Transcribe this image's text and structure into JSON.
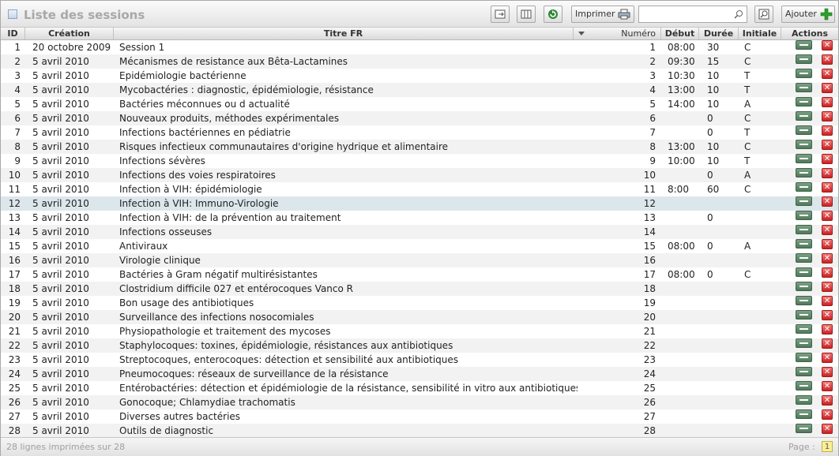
{
  "header": {
    "title": "Liste des sessions",
    "print_label": "Imprimer",
    "add_label": "Ajouter",
    "search_value": ""
  },
  "columns": {
    "id": "ID",
    "creation": "Création",
    "titre": "Titre FR",
    "numero": "Numéro",
    "debut": "Début",
    "duree": "Durée",
    "initiale": "Initiale",
    "actions": "Actions"
  },
  "rows": [
    {
      "id": "1",
      "creation": "20 octobre 2009",
      "titre": "Session 1",
      "numero": "1",
      "debut": "08:00",
      "duree": "30",
      "initiale": "C"
    },
    {
      "id": "2",
      "creation": "5 avril 2010",
      "titre": "Mécanismes de resistance aux Bêta-Lactamines",
      "numero": "2",
      "debut": "09:30",
      "duree": "15",
      "initiale": "C"
    },
    {
      "id": "3",
      "creation": "5 avril 2010",
      "titre": "Epidémiologie bactérienne",
      "numero": "3",
      "debut": "10:30",
      "duree": "10",
      "initiale": "T"
    },
    {
      "id": "4",
      "creation": "5 avril 2010",
      "titre": "Mycobactéries : diagnostic, épidémiologie, résistance",
      "numero": "4",
      "debut": "13:00",
      "duree": "10",
      "initiale": "T"
    },
    {
      "id": "5",
      "creation": "5 avril 2010",
      "titre": "Bactéries méconnues ou d   actualité",
      "numero": "5",
      "debut": "14:00",
      "duree": "10",
      "initiale": "A"
    },
    {
      "id": "6",
      "creation": "5 avril 2010",
      "titre": "Nouveaux produits, méthodes expérimentales",
      "numero": "6",
      "debut": "",
      "duree": "0",
      "initiale": "C"
    },
    {
      "id": "7",
      "creation": "5 avril 2010",
      "titre": "Infections bactériennes en pédiatrie",
      "numero": "7",
      "debut": "",
      "duree": "0",
      "initiale": "T"
    },
    {
      "id": "8",
      "creation": "5 avril 2010",
      "titre": "Risques infectieux communautaires d'origine hydrique et alimentaire",
      "numero": "8",
      "debut": "13:00",
      "duree": "10",
      "initiale": "C"
    },
    {
      "id": "9",
      "creation": "5 avril 2010",
      "titre": "Infections sévères",
      "numero": "9",
      "debut": "10:00",
      "duree": "10",
      "initiale": "T"
    },
    {
      "id": "10",
      "creation": "5 avril 2010",
      "titre": "Infections des voies respiratoires",
      "numero": "10",
      "debut": "",
      "duree": "0",
      "initiale": "A"
    },
    {
      "id": "11",
      "creation": "5 avril 2010",
      "titre": "Infection à VIH: épidémiologie",
      "numero": "11",
      "debut": "8:00",
      "duree": "60",
      "initiale": "C"
    },
    {
      "id": "12",
      "creation": "5 avril 2010",
      "titre": "Infection à VIH: Immuno-Virologie",
      "numero": "12",
      "debut": "",
      "duree": "",
      "initiale": ""
    },
    {
      "id": "13",
      "creation": "5 avril 2010",
      "titre": "Infection à VIH: de la prévention au traitement",
      "numero": "13",
      "debut": "",
      "duree": "0",
      "initiale": ""
    },
    {
      "id": "14",
      "creation": "5 avril 2010",
      "titre": "Infections osseuses",
      "numero": "14",
      "debut": "",
      "duree": "",
      "initiale": ""
    },
    {
      "id": "15",
      "creation": "5 avril 2010",
      "titre": "Antiviraux",
      "numero": "15",
      "debut": "08:00",
      "duree": "0",
      "initiale": "A"
    },
    {
      "id": "16",
      "creation": "5 avril 2010",
      "titre": "Virologie clinique",
      "numero": "16",
      "debut": "",
      "duree": "",
      "initiale": ""
    },
    {
      "id": "17",
      "creation": "5 avril 2010",
      "titre": "Bactéries à Gram négatif multirésistantes",
      "numero": "17",
      "debut": "08:00",
      "duree": "0",
      "initiale": "C"
    },
    {
      "id": "18",
      "creation": "5 avril 2010",
      "titre": "Clostridium difficile 027 et entérocoques Vanco R",
      "numero": "18",
      "debut": "",
      "duree": "",
      "initiale": ""
    },
    {
      "id": "19",
      "creation": "5 avril 2010",
      "titre": "Bon usage des antibiotiques",
      "numero": "19",
      "debut": "",
      "duree": "",
      "initiale": ""
    },
    {
      "id": "20",
      "creation": "5 avril 2010",
      "titre": "Surveillance des infections nosocomiales",
      "numero": "20",
      "debut": "",
      "duree": "",
      "initiale": ""
    },
    {
      "id": "21",
      "creation": "5 avril 2010",
      "titre": "Physiopathologie et traitement des mycoses",
      "numero": "21",
      "debut": "",
      "duree": "",
      "initiale": ""
    },
    {
      "id": "22",
      "creation": "5 avril 2010",
      "titre": "Staphylocoques: toxines, épidémiologie, résistances aux antibiotiques",
      "numero": "22",
      "debut": "",
      "duree": "",
      "initiale": ""
    },
    {
      "id": "23",
      "creation": "5 avril 2010",
      "titre": "Streptocoques, enterocoques: détection et sensibilité aux antibiotiques",
      "numero": "23",
      "debut": "",
      "duree": "",
      "initiale": ""
    },
    {
      "id": "24",
      "creation": "5 avril 2010",
      "titre": "Pneumocoques: réseaux de surveillance de la résistance",
      "numero": "24",
      "debut": "",
      "duree": "",
      "initiale": ""
    },
    {
      "id": "25",
      "creation": "5 avril 2010",
      "titre": "Entérobactéries: détection et épidémiologie de la résistance, sensibilité in vitro aux antibiotiques",
      "numero": "25",
      "debut": "",
      "duree": "",
      "initiale": ""
    },
    {
      "id": "26",
      "creation": "5 avril 2010",
      "titre": "Gonocoque; Chlamydiae trachomatis",
      "numero": "26",
      "debut": "",
      "duree": "",
      "initiale": ""
    },
    {
      "id": "27",
      "creation": "5 avril 2010",
      "titre": "Diverses autres bactéries",
      "numero": "27",
      "debut": "",
      "duree": "",
      "initiale": ""
    },
    {
      "id": "28",
      "creation": "5 avril 2010",
      "titre": "Outils de diagnostic",
      "numero": "28",
      "debut": "",
      "duree": "",
      "initiale": ""
    }
  ],
  "selected_row": 12,
  "footer": {
    "summary": "28 lignes imprimées sur 28",
    "page_label": "Page :",
    "current_page": "1"
  },
  "icons": {
    "title": "sessions-icon",
    "export": "export-icon",
    "columns": "columns-icon",
    "refresh": "refresh-icon",
    "print": "printer-icon",
    "search": "search-icon",
    "advanced_search": "advanced-search-icon",
    "add": "plus-icon",
    "edit": "edit-icon",
    "delete": "delete-icon"
  },
  "colors": {
    "title": "#a8a8a8",
    "selected_row": "#dce7ec",
    "alt_row": "#f2f2f2",
    "add_icon": "#2aa02a",
    "refresh_icon": "#2f8a3a",
    "delete_button": "#d23b3b",
    "edit_button": "#5d8668"
  }
}
